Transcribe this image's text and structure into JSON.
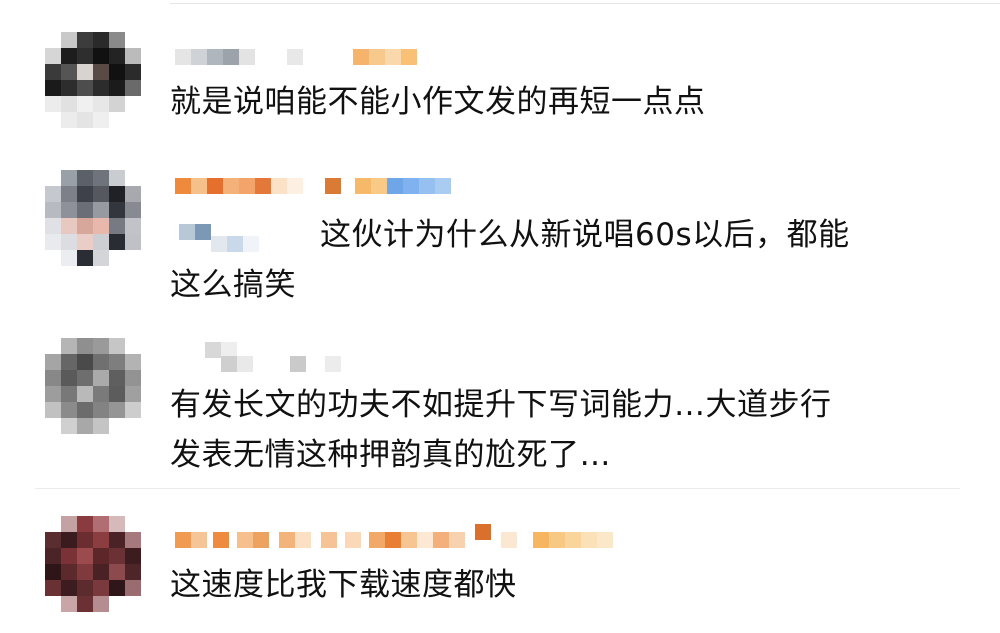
{
  "comments": [
    {
      "text_lines": [
        "就是说咱能不能小作文发的再短一点点"
      ]
    },
    {
      "text_lines": [
        "这伙计为什么从新说唱60s以后，都能",
        "这么搞笑"
      ]
    },
    {
      "text_lines": [
        "有发长文的功夫不如提升下写词能力…大道步行",
        "发表无情这种押韵真的尬死了…"
      ]
    },
    {
      "text_lines": [
        "这速度比我下载速度都快"
      ]
    }
  ]
}
